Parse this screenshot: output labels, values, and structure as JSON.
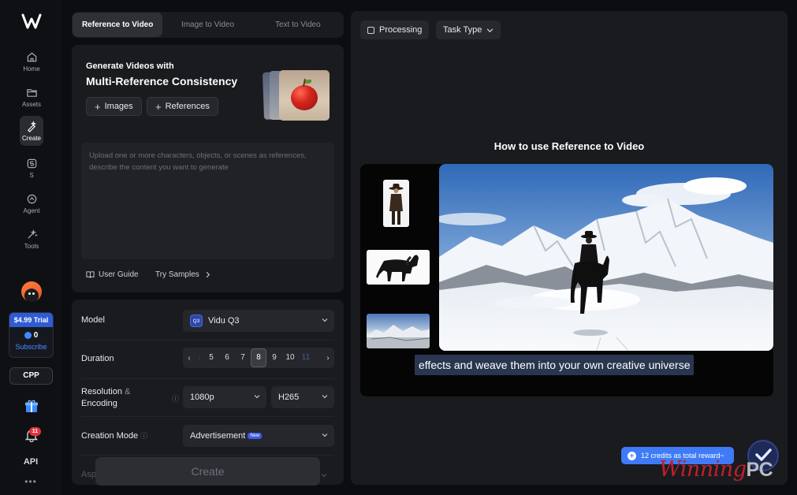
{
  "nav": {
    "items": [
      {
        "label": "Home",
        "icon": "home-icon"
      },
      {
        "label": "Assets",
        "icon": "folder-icon"
      },
      {
        "label": "Create",
        "icon": "wand-pen-icon",
        "active": true
      },
      {
        "label": "S",
        "icon": "s-badge-icon"
      },
      {
        "label": "Agent",
        "icon": "agent-icon"
      },
      {
        "label": "Tools",
        "icon": "magic-wand-icon"
      }
    ],
    "trial_price": "$4.99 Trial",
    "credits": "0",
    "subscribe_label": "Subscribe",
    "cpp_label": "CPP",
    "notification_count": "11",
    "api_label": "API",
    "more_label": "•••"
  },
  "tabs": [
    {
      "label": "Reference to Video",
      "active": true
    },
    {
      "label": "Image to Video",
      "active": false
    },
    {
      "label": "Text to Video",
      "active": false
    }
  ],
  "generator": {
    "title_line1": "Generate Videos with",
    "title_line2": "Multi-Reference Consistency",
    "images_button": "Images",
    "references_button": "References",
    "prompt_placeholder": "Upload one or more characters, objects, or scenes as references, describe the content you want to generate",
    "user_guide_label": "User Guide",
    "try_samples_label": "Try Samples"
  },
  "settings": {
    "model_label": "Model",
    "model_badge": "Q3",
    "model_value": "Vidu Q3",
    "duration_label": "Duration",
    "duration_options": [
      "5",
      "6",
      "7",
      "8",
      "9",
      "10",
      "11"
    ],
    "duration_selected": "8",
    "resolution_label": "Resolution",
    "resolution_and": "&",
    "encoding_label": "Encoding",
    "resolution_value": "1080p",
    "encoding_value": "H265",
    "creation_mode_label": "Creation Mode",
    "creation_mode_value": "Advertisement",
    "new_badge": "New",
    "partial_label": "Asp"
  },
  "create_button": "Create",
  "right": {
    "processing_label": "Processing",
    "task_type_label": "Task Type",
    "howto_title": "How to use Reference to Video",
    "caption": "effects and weave them into your own creative universe",
    "reward_text": "12 credits as total reward~"
  },
  "watermark": {
    "text": "Winning",
    "suffix": "PC"
  },
  "colors": {
    "accent": "#3f7bf6",
    "badge_red": "#e5333b",
    "panel": "#1a1b1f"
  }
}
